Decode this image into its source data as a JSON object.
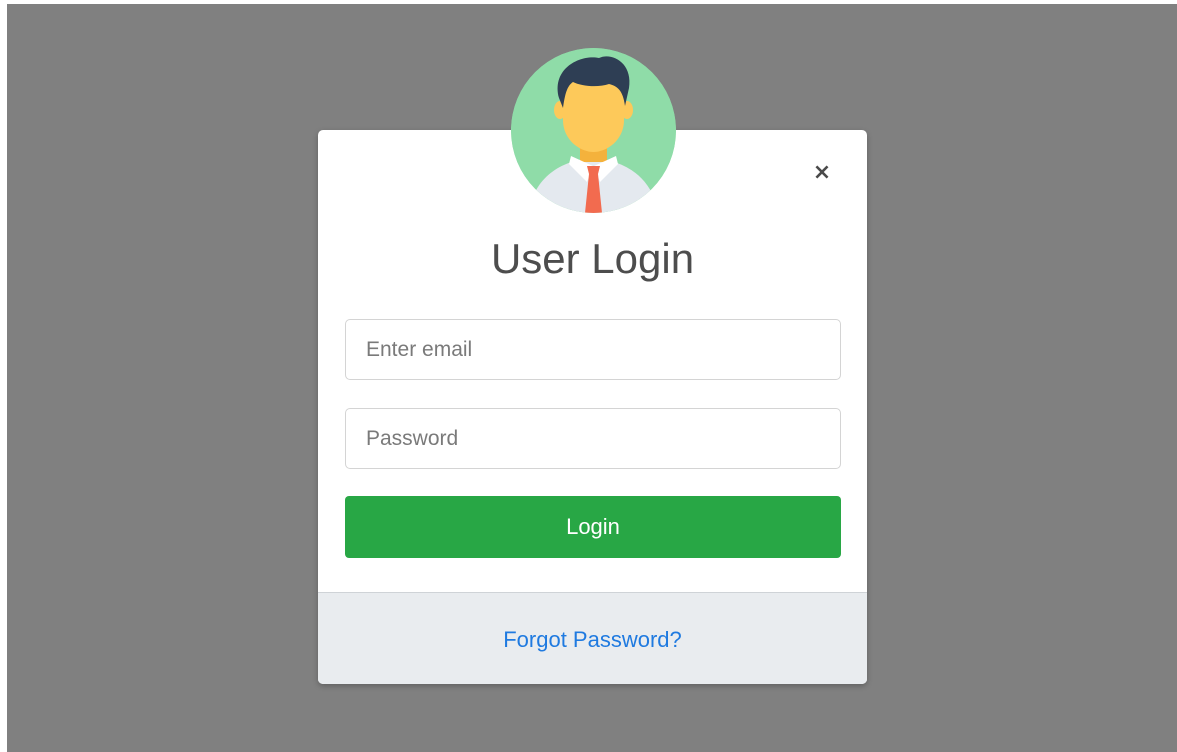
{
  "dialog": {
    "close_symbol": "×",
    "title": "User Login",
    "email_placeholder": "Enter email",
    "password_placeholder": "Password",
    "login_label": "Login",
    "forgot_password_label": "Forgot Password?"
  },
  "icons": {
    "avatar": "user-avatar-icon",
    "close": "close-icon"
  },
  "colors": {
    "backdrop": "#808080",
    "login_button": "#28a745",
    "link": "#1f7ae0",
    "avatar_background": "#8fdca8",
    "tie": "#f26b4f",
    "hair": "#2e3e54",
    "skin": "#fdc95a"
  }
}
